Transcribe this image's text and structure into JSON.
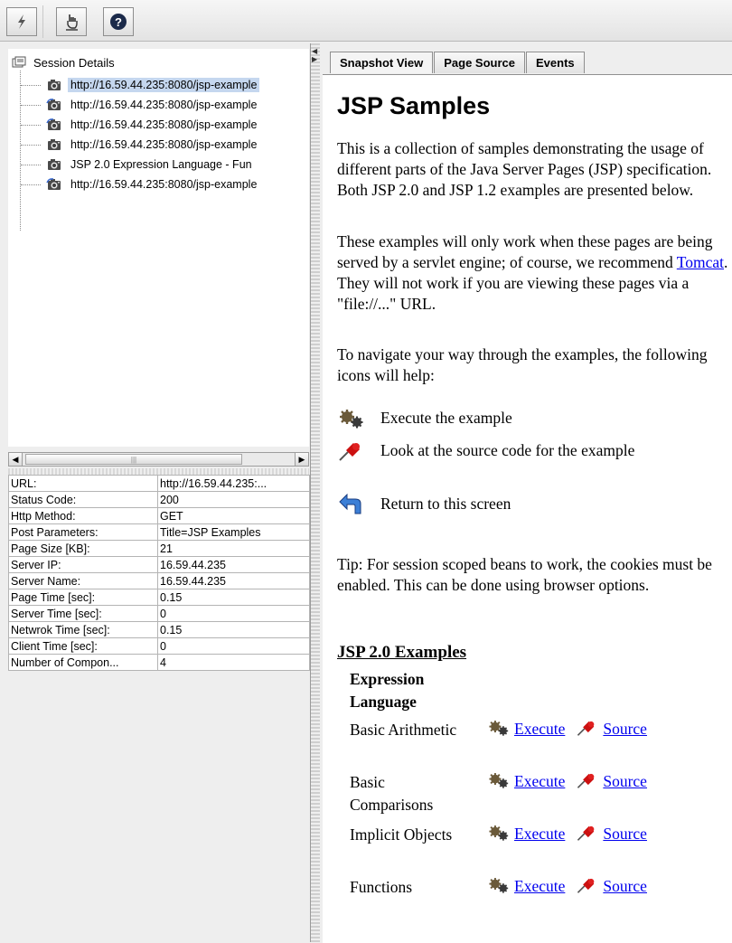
{
  "toolbar": {
    "buttons": [
      {
        "name": "lightning-icon"
      },
      {
        "name": "hand-cursor-icon"
      },
      {
        "name": "help-icon"
      }
    ]
  },
  "session_tree": {
    "root_label": "Session Details",
    "items": [
      {
        "label": "http://16.59.44.235:8080/jsp-example",
        "icon": "camera-icon",
        "selected": true
      },
      {
        "label": "http://16.59.44.235:8080/jsp-example",
        "icon": "camera-refresh-icon",
        "selected": false
      },
      {
        "label": "http://16.59.44.235:8080/jsp-example",
        "icon": "camera-refresh-icon",
        "selected": false
      },
      {
        "label": "http://16.59.44.235:8080/jsp-example",
        "icon": "camera-icon",
        "selected": false
      },
      {
        "label": "JSP 2.0 Expression Language - Fun",
        "icon": "camera-icon",
        "selected": false
      },
      {
        "label": "http://16.59.44.235:8080/jsp-example",
        "icon": "camera-refresh-icon",
        "selected": false
      }
    ]
  },
  "properties": [
    {
      "key": "URL:",
      "value": "http://16.59.44.235:..."
    },
    {
      "key": "Status Code:",
      "value": "200"
    },
    {
      "key": "Http Method:",
      "value": "GET"
    },
    {
      "key": "Post Parameters:",
      "value": "Title=JSP Examples"
    },
    {
      "key": "Page Size [KB]:",
      "value": "21"
    },
    {
      "key": "Server IP:",
      "value": "16.59.44.235"
    },
    {
      "key": "Server Name:",
      "value": "16.59.44.235"
    },
    {
      "key": "Page Time [sec]:",
      "value": "0.15"
    },
    {
      "key": "Server Time [sec]:",
      "value": "0"
    },
    {
      "key": "Netwrok Time [sec]:",
      "value": "0.15"
    },
    {
      "key": "Client Time [sec]:",
      "value": "0"
    },
    {
      "key": "Number of Compon...",
      "value": "4"
    }
  ],
  "tabs": [
    {
      "label": "Snapshot View",
      "active": true
    },
    {
      "label": "Page Source",
      "active": false
    },
    {
      "label": "Events",
      "active": false
    }
  ],
  "page": {
    "title": "JSP Samples",
    "intro": "This is a collection of samples demonstrating the usage of different parts of the Java Server Pages (JSP) specification. Both JSP 2.0 and JSP 1.2 examples are presented below.",
    "servlet_before": "These examples will only work when these pages are being served by a servlet engine; of course, we recommend ",
    "servlet_link": "Tomcat",
    "servlet_after": ". They will not work if you are viewing these pages via a \"file://...\" URL.",
    "navigate": "To navigate your way through the examples, the following icons will help:",
    "legend": [
      {
        "icon": "gears-icon",
        "text": "Execute the example"
      },
      {
        "icon": "pushpin-icon",
        "text": "Look at the source code for the example"
      },
      {
        "icon": "return-arrow-icon",
        "text": "Return to this screen"
      }
    ],
    "tip": "Tip: For session scoped beans to work, the cookies must be enabled. This can be done using browser options.",
    "section_title": "JSP 2.0 Examples",
    "subsection_title": "Expression Language",
    "examples": [
      {
        "label": "Basic Arithmetic",
        "execute": "Execute",
        "source": "Source"
      },
      {
        "label": "Basic Comparisons",
        "execute": "Execute",
        "source": "Source"
      },
      {
        "label": "Implicit Objects",
        "execute": "Execute",
        "source": "Source"
      },
      {
        "label": "Functions",
        "execute": "Execute",
        "source": "Source"
      }
    ]
  }
}
